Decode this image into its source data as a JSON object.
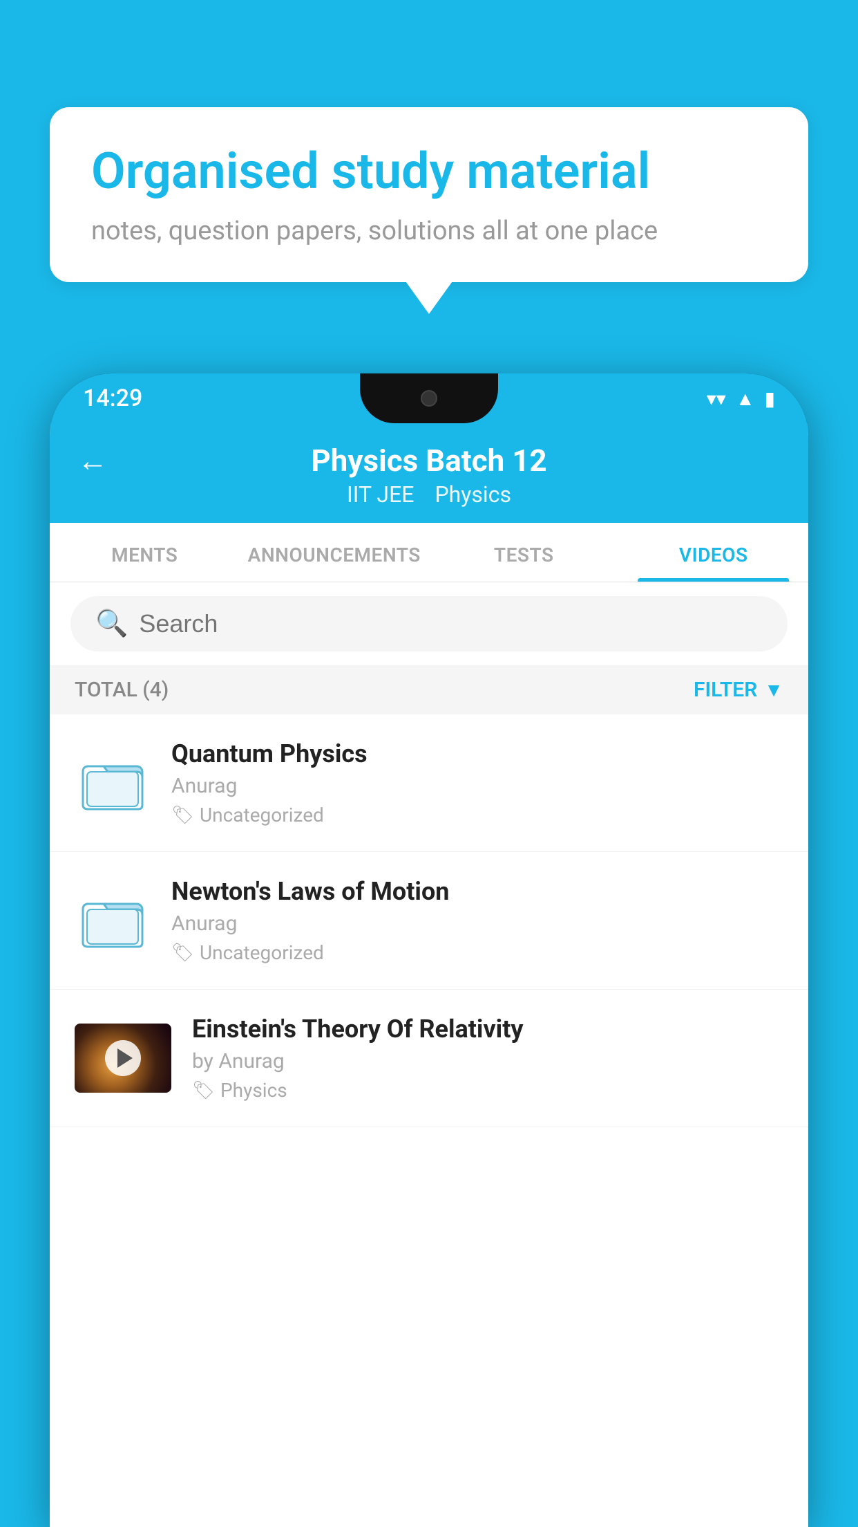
{
  "background_color": "#1ab8e8",
  "speech_bubble": {
    "heading": "Organised study material",
    "subtext": "notes, question papers, solutions all at one place"
  },
  "phone": {
    "status_bar": {
      "time": "14:29",
      "icons": [
        "wifi",
        "signal",
        "battery"
      ]
    },
    "header": {
      "back_label": "←",
      "title": "Physics Batch 12",
      "subtitle_left": "IIT JEE",
      "subtitle_right": "Physics"
    },
    "tabs": [
      {
        "label": "MENTS",
        "active": false
      },
      {
        "label": "ANNOUNCEMENTS",
        "active": false
      },
      {
        "label": "TESTS",
        "active": false
      },
      {
        "label": "VIDEOS",
        "active": true
      }
    ],
    "search": {
      "placeholder": "Search"
    },
    "filter_bar": {
      "total_label": "TOTAL (4)",
      "filter_label": "FILTER"
    },
    "videos": [
      {
        "id": 1,
        "title": "Quantum Physics",
        "author": "Anurag",
        "tag": "Uncategorized",
        "type": "folder",
        "thumbnail": null
      },
      {
        "id": 2,
        "title": "Newton's Laws of Motion",
        "author": "Anurag",
        "tag": "Uncategorized",
        "type": "folder",
        "thumbnail": null
      },
      {
        "id": 3,
        "title": "Einstein's Theory Of Relativity",
        "author": "by Anurag",
        "tag": "Physics",
        "type": "video",
        "thumbnail": "einstein"
      }
    ]
  }
}
